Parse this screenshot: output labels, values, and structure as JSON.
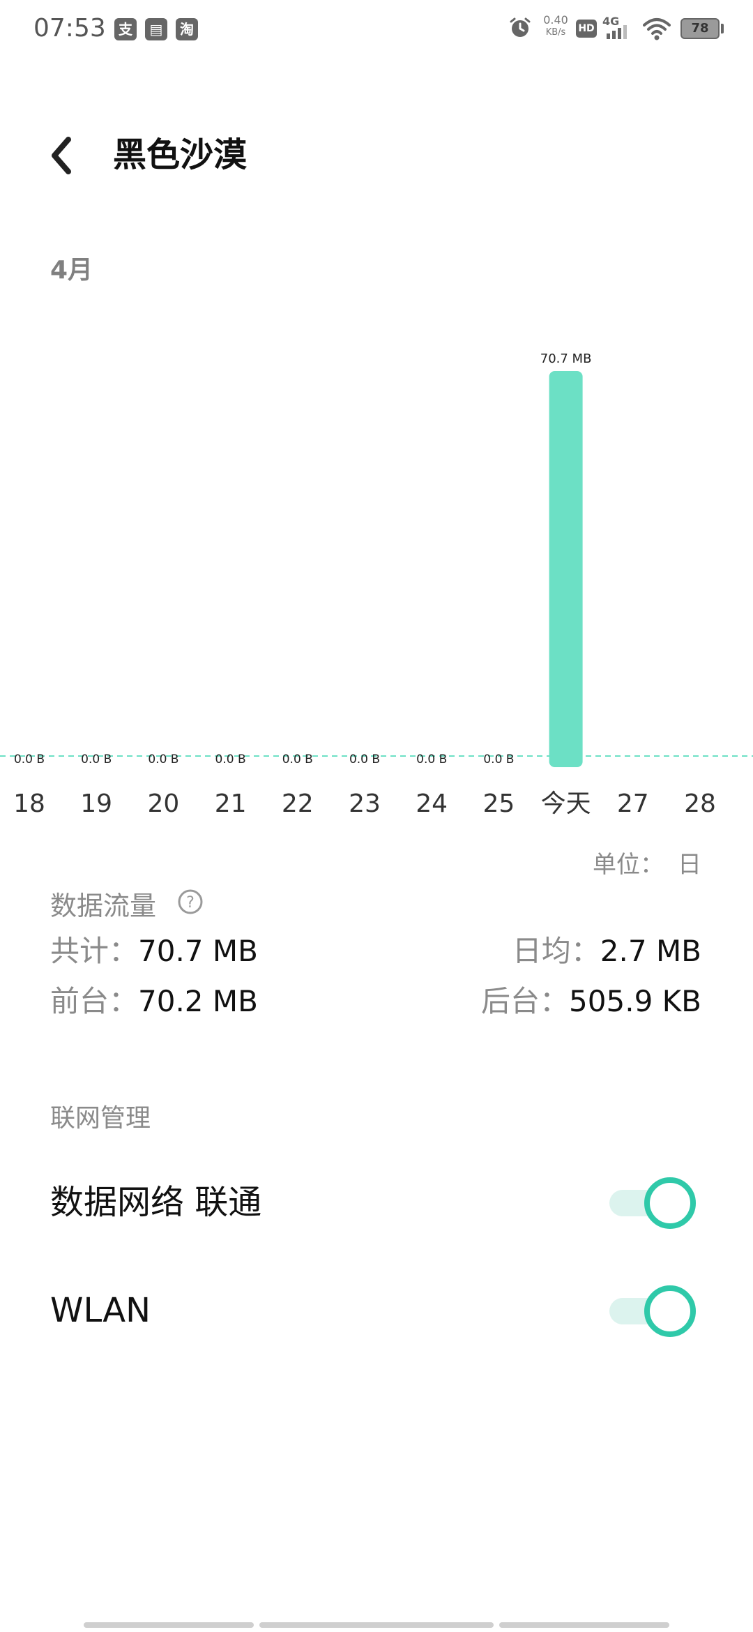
{
  "status_bar": {
    "time": "07:53",
    "app_icons": [
      {
        "name": "alipay-icon",
        "glyph": "支"
      },
      {
        "name": "card-icon",
        "glyph": "▤"
      },
      {
        "name": "taobao-icon",
        "glyph": "淘"
      }
    ],
    "speed_value": "0.40",
    "speed_unit": "KB/s",
    "hd_label": "HD",
    "network_label": "4G",
    "battery": "78"
  },
  "header": {
    "title": "黑色沙漠"
  },
  "month_label": "4月",
  "chart_data": {
    "type": "bar",
    "categories": [
      "18",
      "19",
      "20",
      "21",
      "22",
      "23",
      "24",
      "25",
      "今天",
      "27",
      "28"
    ],
    "values_mb": [
      0,
      0,
      0,
      0,
      0,
      0,
      0,
      0,
      70.7,
      null,
      null
    ],
    "value_labels": [
      "0.0 B",
      "0.0 B",
      "0.0 B",
      "0.0 B",
      "0.0 B",
      "0.0 B",
      "0.0 B",
      "0.0 B",
      "70.7 MB",
      "",
      ""
    ],
    "bar_color": "#6ce0c5",
    "baseline_color": "#6ce0c5"
  },
  "unit": {
    "label": "单位：",
    "value": "日"
  },
  "data_flow": {
    "title": "数据流量",
    "total_label": "共计：",
    "total_value": "70.7 MB",
    "daily_avg_label": "日均：",
    "daily_avg_value": "2.7 MB",
    "foreground_label": "前台：",
    "foreground_value": "70.2 MB",
    "background_label": "后台：",
    "background_value": "505.9 KB"
  },
  "network_management": {
    "title": "联网管理",
    "items": [
      {
        "label": "数据网络 联通",
        "enabled": true
      },
      {
        "label": "WLAN",
        "enabled": true
      }
    ]
  },
  "colors": {
    "accent": "#2fc9a9",
    "accent_light": "#dcf3ee"
  }
}
